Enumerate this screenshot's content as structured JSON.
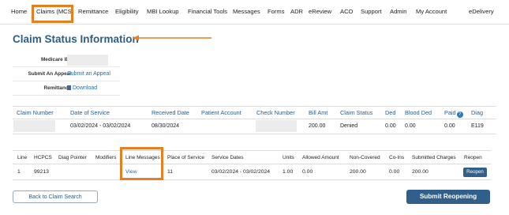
{
  "nav": {
    "home": "Home",
    "claims_mcs": "Claims (MCS)",
    "remittance": "Remittance",
    "eligibility": "Eligibility",
    "mbi_lookup": "MBI Lookup",
    "financial_tools": "Financial Tools",
    "messages": "Messages",
    "forms": "Forms",
    "adr": "ADR",
    "ereview": "eReview",
    "aco": "ACO",
    "support": "Support",
    "admin": "Admin",
    "my_account": "My Account",
    "edelivery": "eDelivery"
  },
  "page": {
    "title": "Claim Status Information"
  },
  "info": {
    "medicare_id_label": "Medicare ID:",
    "medicare_id_value": "",
    "appeal_label": "Submit An Appeal",
    "appeal_link": "Submit an Appeal",
    "remittance_label": "Remittance",
    "download_link": "Download"
  },
  "claim_table": {
    "headers": {
      "claim_number": "Claim Number",
      "date_of_service": "Date of Service",
      "received_date": "Received Date",
      "patient_account": "Patient Account",
      "check_number": "Check Number",
      "bill_amt": "Bill Amt",
      "claim_status": "Claim Status",
      "ded": "Ded",
      "blood_ded": "Blood Ded",
      "paid": "Paid",
      "diag": "Diag"
    },
    "row": {
      "claim_number": "",
      "date_of_service": "03/02/2024 - 03/02/2024",
      "received_date": "08/30/2024",
      "patient_account": "",
      "check_number": "",
      "bill_amt": "200.00",
      "claim_status": "Denied",
      "ded": "0.00",
      "blood_ded": "0.00",
      "paid": "0.00",
      "diag": "E119"
    }
  },
  "line_table": {
    "headers": {
      "line": "Line",
      "hcpcs": "HCPCS",
      "diag_pointer": "Diag Pointer",
      "modifiers": "Modifiers",
      "line_messages": "Line Messages",
      "place_of_service": "Place of Service",
      "service_dates": "Service Dates",
      "units": "Units",
      "allowed_amount": "Allowed Amount",
      "non_covered": "Non-Covered",
      "co_ins": "Co-Ins",
      "submitted_charges": "Submitted Charges",
      "reopen": "Reopen"
    },
    "row": {
      "line": "1",
      "hcpcs": "99213",
      "diag_pointer": "",
      "modifiers": "",
      "line_messages": "View",
      "place_of_service": "11",
      "service_dates": "03/02/2024 - 03/02/2024",
      "units": "1.00",
      "allowed_amount": "0.00",
      "non_covered": "200.00",
      "co_ins": "0.00",
      "submitted_charges": "200.00",
      "reopen_button": "Reopen"
    }
  },
  "buttons": {
    "back": "Back to Claim Search",
    "submit": "Submit Reopening"
  },
  "colors": {
    "highlight": "#e77e22",
    "primary": "#2f5f8a",
    "link": "#2a6aa8",
    "title": "#2d5f86"
  }
}
